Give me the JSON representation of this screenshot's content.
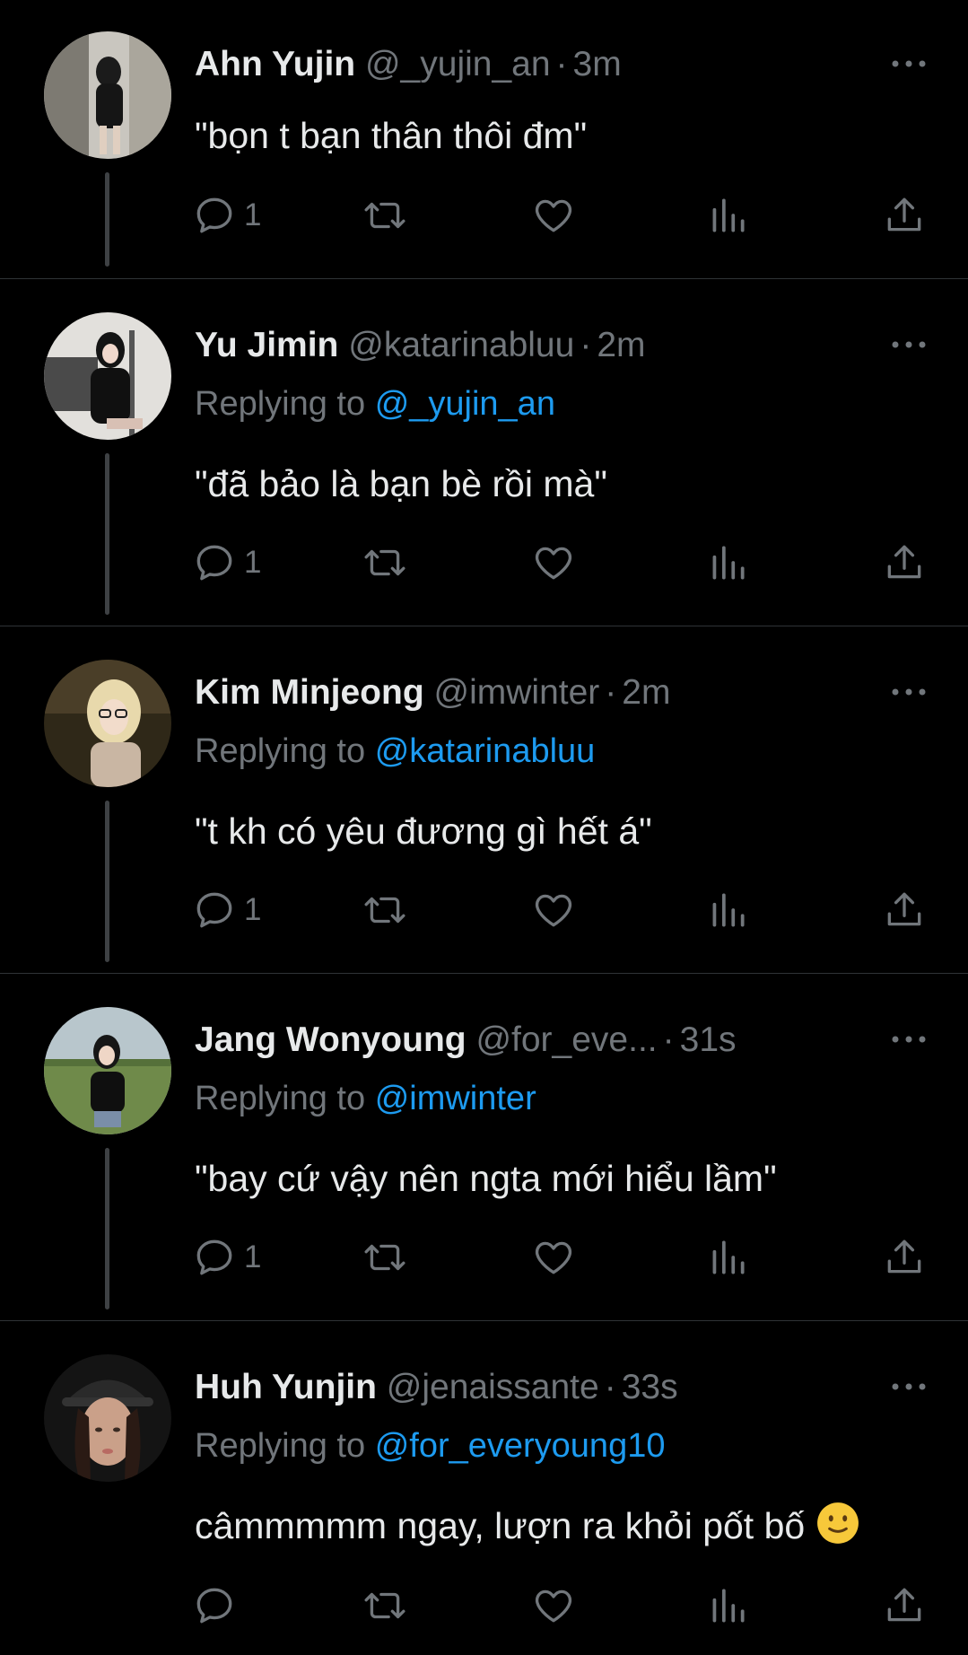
{
  "tweets": [
    {
      "name": "Ahn Yujin",
      "handle": "@_yujin_an",
      "time": "3m",
      "replying_label": "",
      "replying_to": "",
      "text": "\"bọn t bạn thân thôi đm\"",
      "reply_count": "1",
      "avatar_colors": [
        "#b9b9b3",
        "#1a1a1a"
      ]
    },
    {
      "name": "Yu Jimin",
      "handle": "@katarinabluu",
      "time": "2m",
      "replying_label": "Replying to",
      "replying_to": "@_yujin_an",
      "text": "\"đã bảo là bạn bè rồi mà\"",
      "reply_count": "1",
      "avatar_colors": [
        "#d9d6d2",
        "#141414"
      ]
    },
    {
      "name": "Kim Minjeong",
      "handle": "@imwinter",
      "time": "2m",
      "replying_label": "Replying to",
      "replying_to": "@katarinabluu",
      "text": "\"t kh có yêu đương gì hết á\"",
      "reply_count": "1",
      "avatar_colors": [
        "#3a3020",
        "#e9d6a8"
      ]
    },
    {
      "name": "Jang Wonyoung",
      "handle": "@for_eve...",
      "time": "31s",
      "replying_label": "Replying to",
      "replying_to": "@imwinter",
      "text": "\"bay cứ vậy nên ngta mới hiểu lầm\"",
      "reply_count": "1",
      "avatar_colors": [
        "#9fb0b8",
        "#6f8a4a"
      ]
    },
    {
      "name": "Huh Yunjin",
      "handle": "@jenaissante",
      "time": "33s",
      "replying_label": "Replying to",
      "replying_to": "@for_everyoung10",
      "text": "câmmmmm ngay, lượn ra khỏi pốt bố",
      "reply_count": "",
      "avatar_colors": [
        "#1c1c1c",
        "#caa089"
      ]
    }
  ],
  "icons": {
    "reply": "reply-icon",
    "retweet": "retweet-icon",
    "like": "heart-icon",
    "views": "views-icon",
    "share": "share-icon",
    "more": "more-icon"
  },
  "colors": {
    "background": "#000000",
    "text": "#e7e9ea",
    "muted": "#71767b",
    "link": "#1d9bf0",
    "divider": "#2f3336"
  }
}
